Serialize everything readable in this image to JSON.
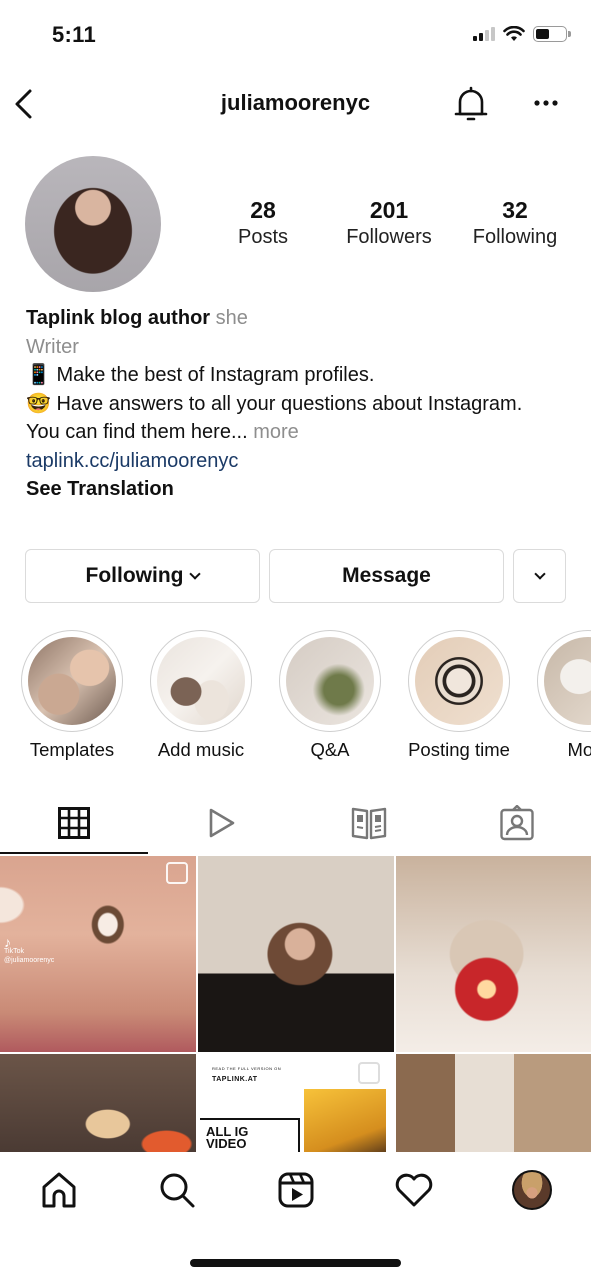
{
  "status_bar": {
    "time": "5:11",
    "icons": [
      "cellular-signal-icon",
      "wifi-icon",
      "battery-icon"
    ],
    "signal_bars_active": 2,
    "signal_bars_total": 4,
    "battery_level_fraction": 0.45
  },
  "header": {
    "username": "juliamoorenyc",
    "back_icon": "chevron-left-icon",
    "notifications_icon": "bell-icon",
    "more_icon": "ellipsis-icon"
  },
  "profile": {
    "stats": [
      {
        "value": "28",
        "label": "Posts"
      },
      {
        "value": "201",
        "label": "Followers"
      },
      {
        "value": "32",
        "label": "Following"
      }
    ],
    "bio": {
      "name": "Taplink blog author",
      "pronouns": "she",
      "category": "Writer",
      "line1_emoji": "📱",
      "line1": "Make the best of Instagram profiles.",
      "line2_emoji": "🤓",
      "line2": "Have answers to all your questions about Instagram.",
      "line3": "You can find them here...",
      "more_label": "more",
      "link": "taplink.cc/juliamoorenyc",
      "see_translation": "See Translation"
    }
  },
  "actions": {
    "following_label": "Following",
    "message_label": "Message",
    "dropdown_icon": "chevron-down-icon"
  },
  "highlights": [
    {
      "label": "Templates"
    },
    {
      "label": "Add music"
    },
    {
      "label": "Q&A"
    },
    {
      "label": "Posting time"
    },
    {
      "label": "Mom"
    }
  ],
  "tabs": [
    {
      "name": "posts-grid",
      "icon": "grid-icon",
      "active": true
    },
    {
      "name": "reels",
      "icon": "play-icon",
      "active": false
    },
    {
      "name": "guides",
      "icon": "guide-book-icon",
      "active": false
    },
    {
      "name": "tagged",
      "icon": "tagged-person-icon",
      "active": false
    }
  ],
  "posts": [
    {
      "tiktok_label": "TikTok",
      "tiktok_handle": "@juliamoorenyc"
    },
    {},
    {},
    {},
    {
      "small_text": "READ THE FULL VERSION ON",
      "brand": "TAPLINK.AT",
      "headline_1": "ALL IG",
      "headline_2": "VIDEO"
    },
    {}
  ],
  "bottom_nav": [
    {
      "name": "home",
      "icon": "home-icon"
    },
    {
      "name": "search",
      "icon": "search-icon"
    },
    {
      "name": "reels",
      "icon": "reels-icon"
    },
    {
      "name": "activity",
      "icon": "heart-icon"
    },
    {
      "name": "profile",
      "icon": "profile-avatar"
    }
  ],
  "colors": {
    "link": "#1b3a66",
    "secondary_text": "#8e8e8e",
    "border": "#dbdbdb",
    "text": "#111111"
  }
}
